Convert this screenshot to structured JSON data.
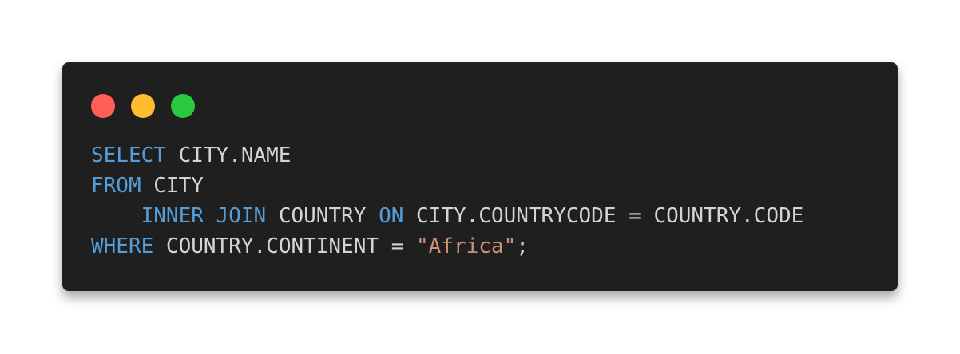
{
  "window": {
    "controls": [
      {
        "name": "close",
        "color": "#ff5f56"
      },
      {
        "name": "minimize",
        "color": "#ffbd2e"
      },
      {
        "name": "maximize",
        "color": "#27c93f"
      }
    ]
  },
  "code": {
    "language": "sql",
    "lines": [
      [
        {
          "t": "kw",
          "text": "SELECT"
        },
        {
          "t": "plain",
          "text": " CITY.NAME"
        }
      ],
      [
        {
          "t": "kw",
          "text": "FROM"
        },
        {
          "t": "plain",
          "text": " CITY"
        }
      ],
      [
        {
          "t": "plain",
          "text": "    "
        },
        {
          "t": "kw",
          "text": "INNER JOIN"
        },
        {
          "t": "plain",
          "text": " COUNTRY "
        },
        {
          "t": "kw",
          "text": "ON"
        },
        {
          "t": "plain",
          "text": " CITY.COUNTRYCODE = COUNTRY.CODE"
        }
      ],
      [
        {
          "t": "kw",
          "text": "WHERE"
        },
        {
          "t": "plain",
          "text": " COUNTRY.CONTINENT = "
        },
        {
          "t": "str",
          "text": "\"Africa\""
        },
        {
          "t": "plain",
          "text": ";"
        }
      ]
    ]
  },
  "colors": {
    "background": "#1f1f1f",
    "keyword": "#569cd6",
    "string": "#ce9178",
    "text": "#d4d4d4"
  }
}
